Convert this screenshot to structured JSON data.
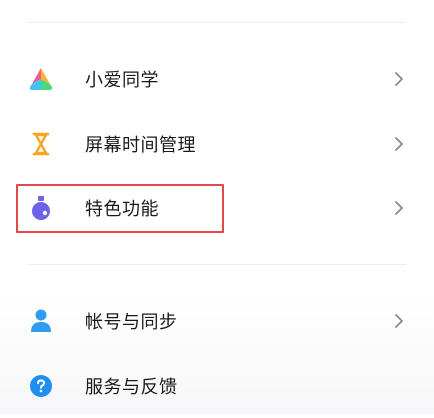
{
  "menu": {
    "items": [
      {
        "label": "小爱同学",
        "icon": "xiaoai-icon",
        "has_chevron": true
      },
      {
        "label": "屏幕时间管理",
        "icon": "hourglass-icon",
        "has_chevron": true
      },
      {
        "label": "特色功能",
        "icon": "flask-icon",
        "has_chevron": true
      },
      {
        "label": "帐号与同步",
        "icon": "person-icon",
        "has_chevron": true
      },
      {
        "label": "服务与反馈",
        "icon": "help-icon",
        "has_chevron": false
      }
    ]
  },
  "colors": {
    "highlight_border": "#e24a4a",
    "hourglass": "#f5a623",
    "flask": "#6c63e8",
    "person": "#2f9bf1",
    "help": "#1e8ef0",
    "chevron": "#8a8a8a"
  }
}
